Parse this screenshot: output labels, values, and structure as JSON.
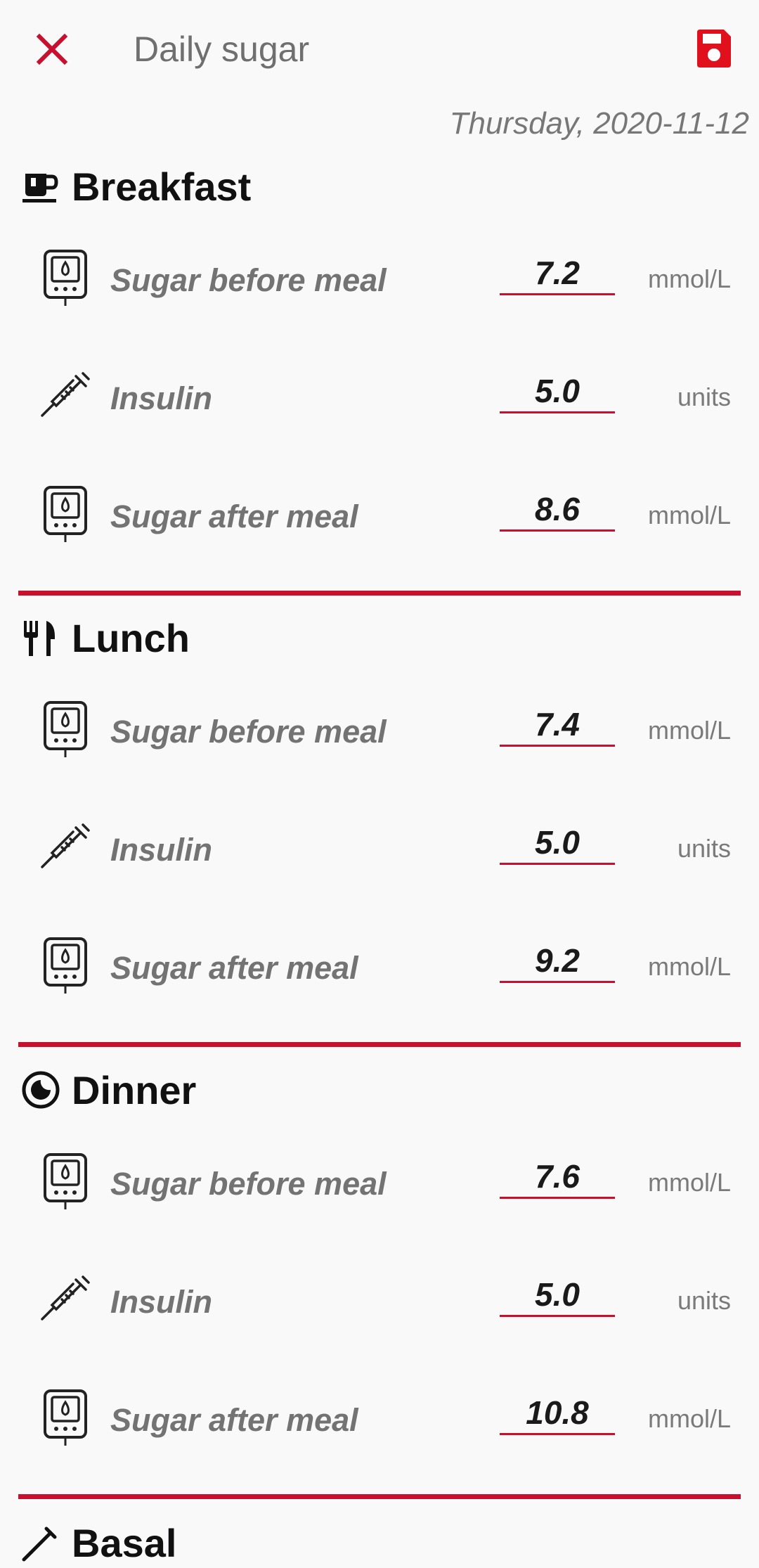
{
  "app": {
    "title": "Daily sugar"
  },
  "date": "Thursday, 2020-11-12",
  "colors": {
    "accent": "#c8102e",
    "save": "#e0101c"
  },
  "icons": {
    "close": "close-icon",
    "save": "save-icon",
    "meter": "glucose-meter-icon",
    "syringe": "syringe-icon"
  },
  "meals": [
    {
      "name": "Breakfast",
      "icon": "coffee-cup-icon",
      "rows": [
        {
          "label": "Sugar before meal",
          "value": "7.2",
          "unit": "mmol/L"
        },
        {
          "label": "Insulin",
          "value": "5.0",
          "unit": "units"
        },
        {
          "label": "Sugar after meal",
          "value": "8.6",
          "unit": "mmol/L"
        }
      ]
    },
    {
      "name": "Lunch",
      "icon": "fork-knife-icon",
      "rows": [
        {
          "label": "Sugar before meal",
          "value": "7.4",
          "unit": "mmol/L"
        },
        {
          "label": "Insulin",
          "value": "5.0",
          "unit": "units"
        },
        {
          "label": "Sugar after meal",
          "value": "9.2",
          "unit": "mmol/L"
        }
      ]
    },
    {
      "name": "Dinner",
      "icon": "moon-icon",
      "rows": [
        {
          "label": "Sugar before meal",
          "value": "7.6",
          "unit": "mmol/L"
        },
        {
          "label": "Insulin",
          "value": "5.0",
          "unit": "units"
        },
        {
          "label": "Sugar after meal",
          "value": "10.8",
          "unit": "mmol/L"
        }
      ]
    },
    {
      "name": "Basal",
      "icon": "syringe-icon"
    }
  ]
}
